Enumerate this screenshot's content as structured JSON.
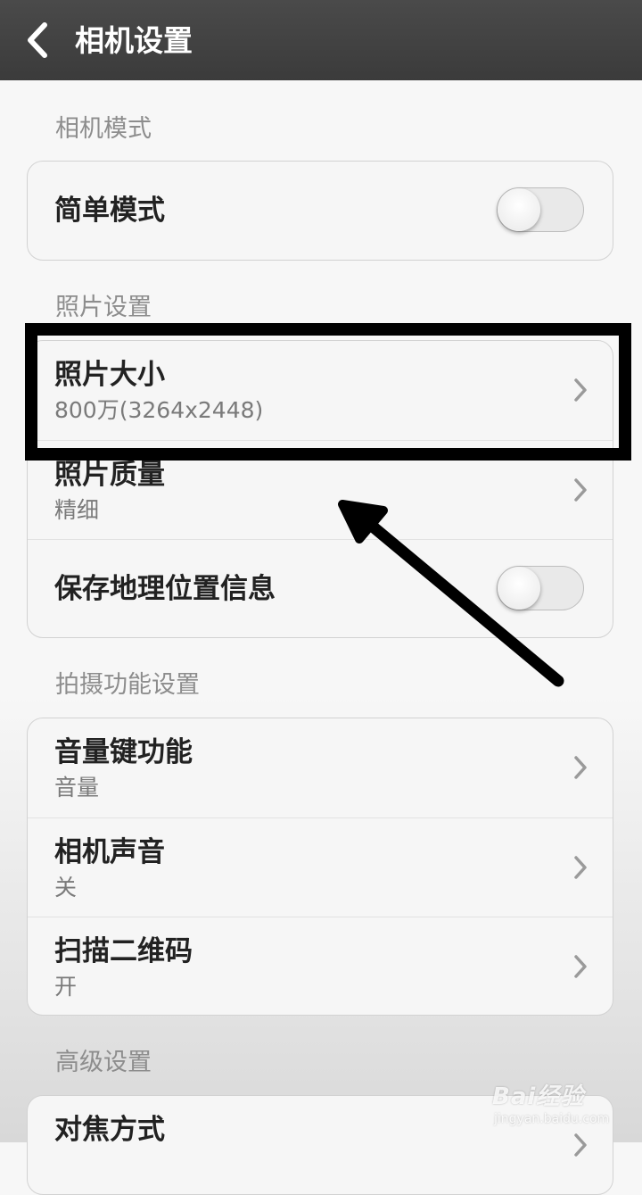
{
  "header": {
    "title": "相机设置"
  },
  "sections": [
    {
      "header": "相机模式",
      "rows": [
        {
          "label": "简单模式",
          "toggle": false
        }
      ]
    },
    {
      "header": "照片设置",
      "rows": [
        {
          "label": "照片大小",
          "value": "800万(3264x2448)"
        },
        {
          "label": "照片质量",
          "value": "精细"
        },
        {
          "label": "保存地理位置信息",
          "toggle": false
        }
      ]
    },
    {
      "header": "拍摄功能设置",
      "rows": [
        {
          "label": "音量键功能",
          "value": "音量"
        },
        {
          "label": "相机声音",
          "value": "关"
        },
        {
          "label": "扫描二维码",
          "value": "开"
        }
      ]
    },
    {
      "header": "高级设置",
      "rows": [
        {
          "label": "对焦方式"
        }
      ]
    }
  ],
  "watermark": {
    "brand": "Bai经验",
    "url": "jingyan.baidu.com"
  },
  "colors": {
    "topbar": "#3f3f3f",
    "annotation": "#000000"
  },
  "icons": [
    "back-arrow-icon",
    "chevron-right-icon",
    "annotation-arrow"
  ]
}
